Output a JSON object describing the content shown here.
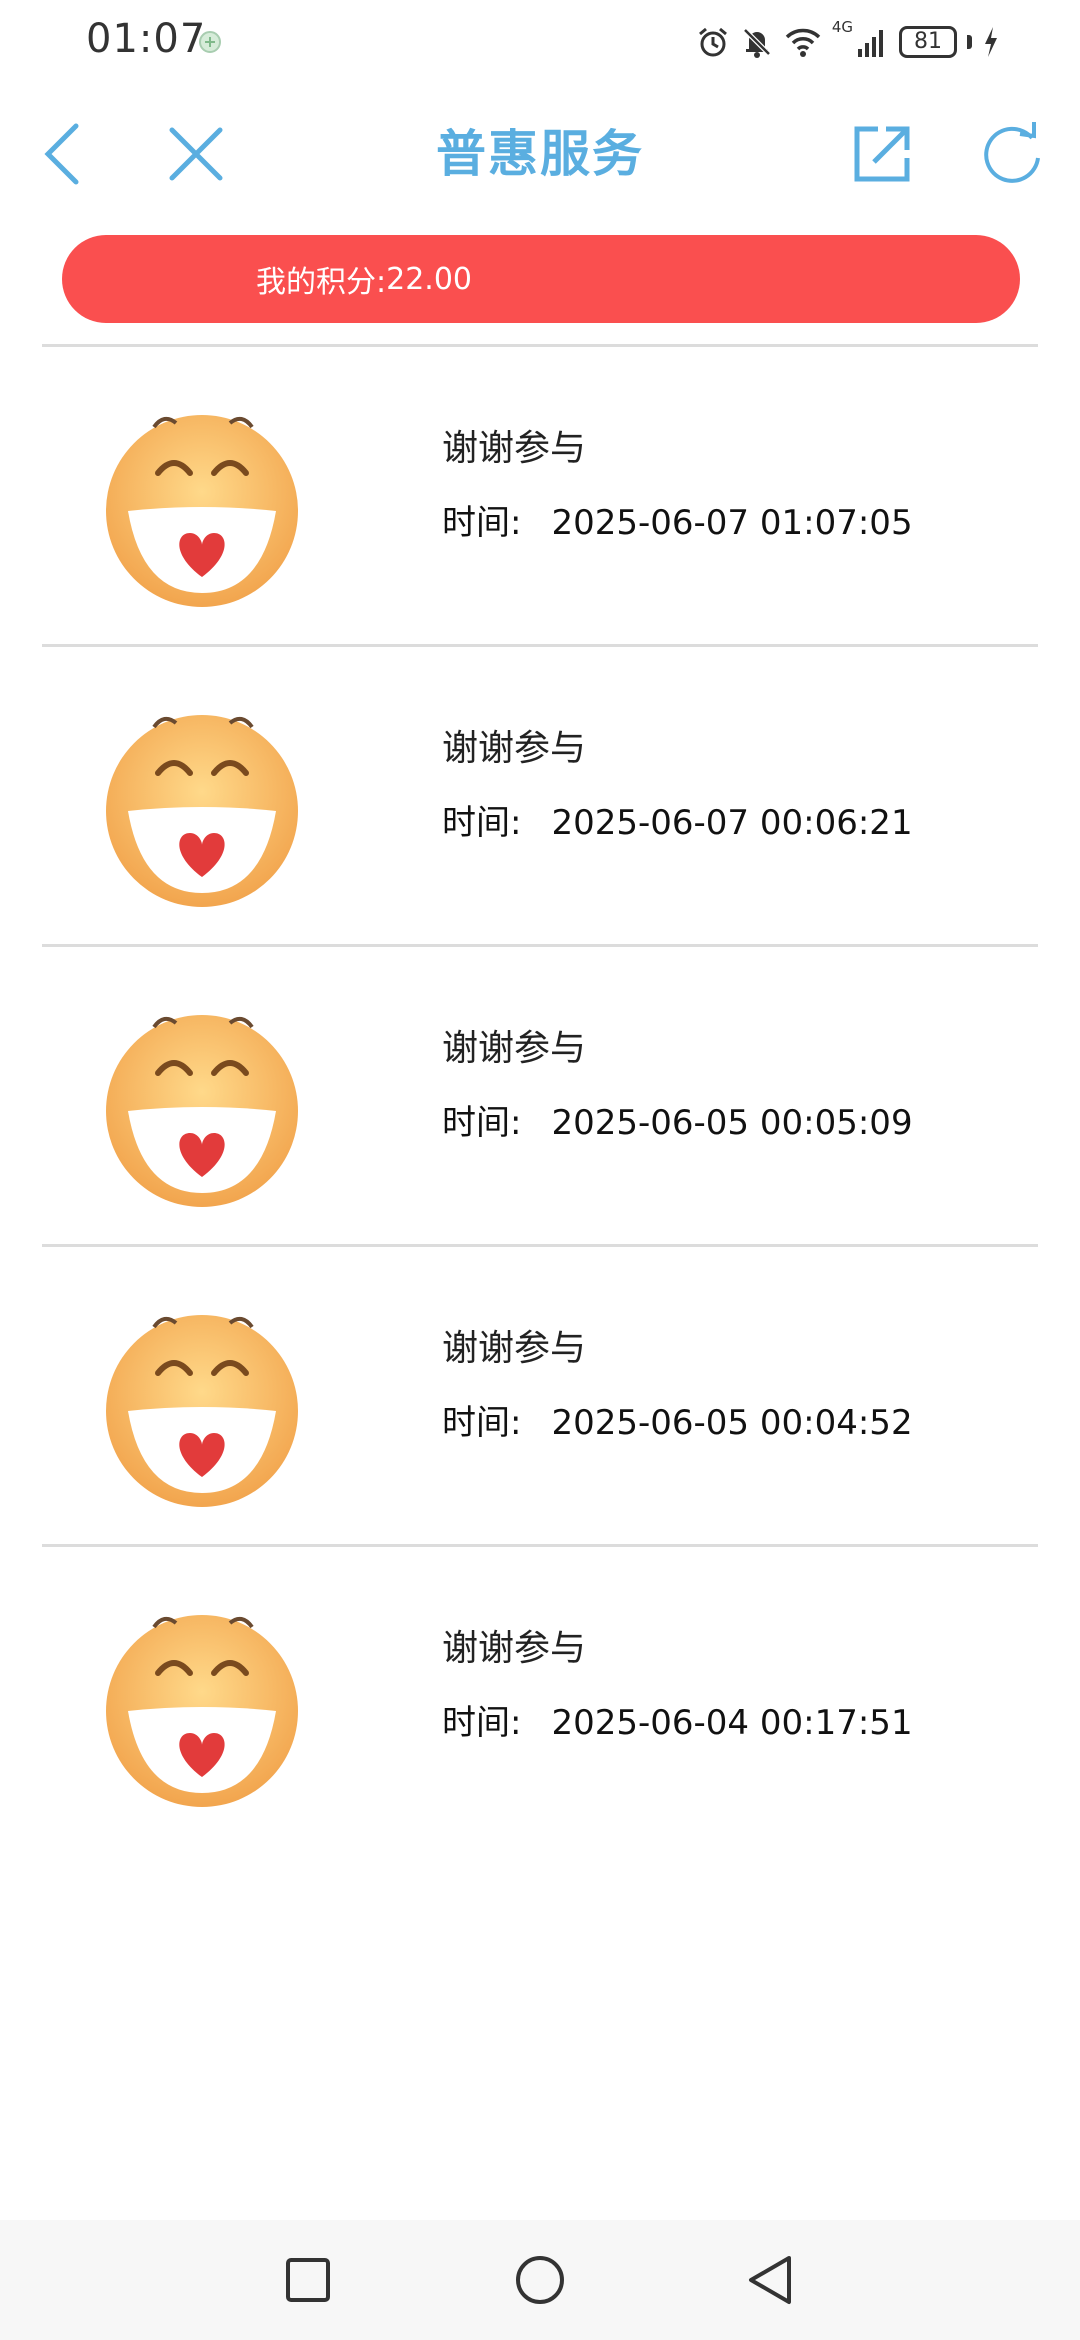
{
  "status_bar": {
    "time": "01:07",
    "network_type": "4G",
    "battery": "81"
  },
  "header": {
    "title": "普惠服务",
    "icons": {
      "back": "chevron-left-icon",
      "close": "close-icon",
      "share": "external-link-icon",
      "refresh": "refresh-icon"
    },
    "accent_color": "#5aaee0"
  },
  "points": {
    "label": "我的积分:",
    "value": "22.00",
    "banner_color": "#fa4f4f"
  },
  "records": [
    {
      "title": "谢谢参与",
      "time_label": "时间:",
      "time": "2025-06-07 01:07:05"
    },
    {
      "title": "谢谢参与",
      "time_label": "时间:",
      "time": "2025-06-07 00:06:21"
    },
    {
      "title": "谢谢参与",
      "time_label": "时间:",
      "time": "2025-06-05 00:05:09"
    },
    {
      "title": "谢谢参与",
      "time_label": "时间:",
      "time": "2025-06-05 00:04:52"
    },
    {
      "title": "谢谢参与",
      "time_label": "时间:",
      "time": "2025-06-04 00:17:51"
    }
  ],
  "nav_bar": {
    "icons": [
      "recents-square-icon",
      "home-circle-icon",
      "back-triangle-icon"
    ]
  }
}
